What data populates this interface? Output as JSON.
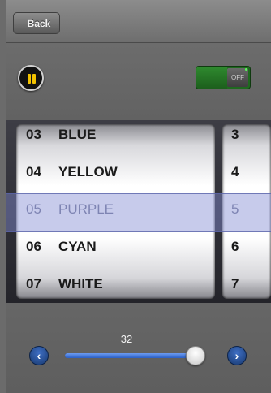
{
  "nav": {
    "back_label": "Back"
  },
  "controls": {
    "pause_icon": "pause-icon",
    "toggle_label": "OFF",
    "toggle_on_color": "#2f8a2f"
  },
  "picker": {
    "main_rows": [
      {
        "num": "03",
        "name": "BLUE"
      },
      {
        "num": "04",
        "name": "YELLOW"
      },
      {
        "num": "05",
        "name": "PURPLE"
      },
      {
        "num": "06",
        "name": "CYAN"
      },
      {
        "num": "07",
        "name": "WHITE"
      }
    ],
    "num_rows": [
      "3",
      "4",
      "5",
      "6",
      "7"
    ],
    "selected_index": 2
  },
  "slider": {
    "value": "32",
    "fraction": 0.96,
    "left_icon": "chevron-left-icon",
    "right_icon": "chevron-right-icon",
    "accent": "#2a60c7"
  }
}
